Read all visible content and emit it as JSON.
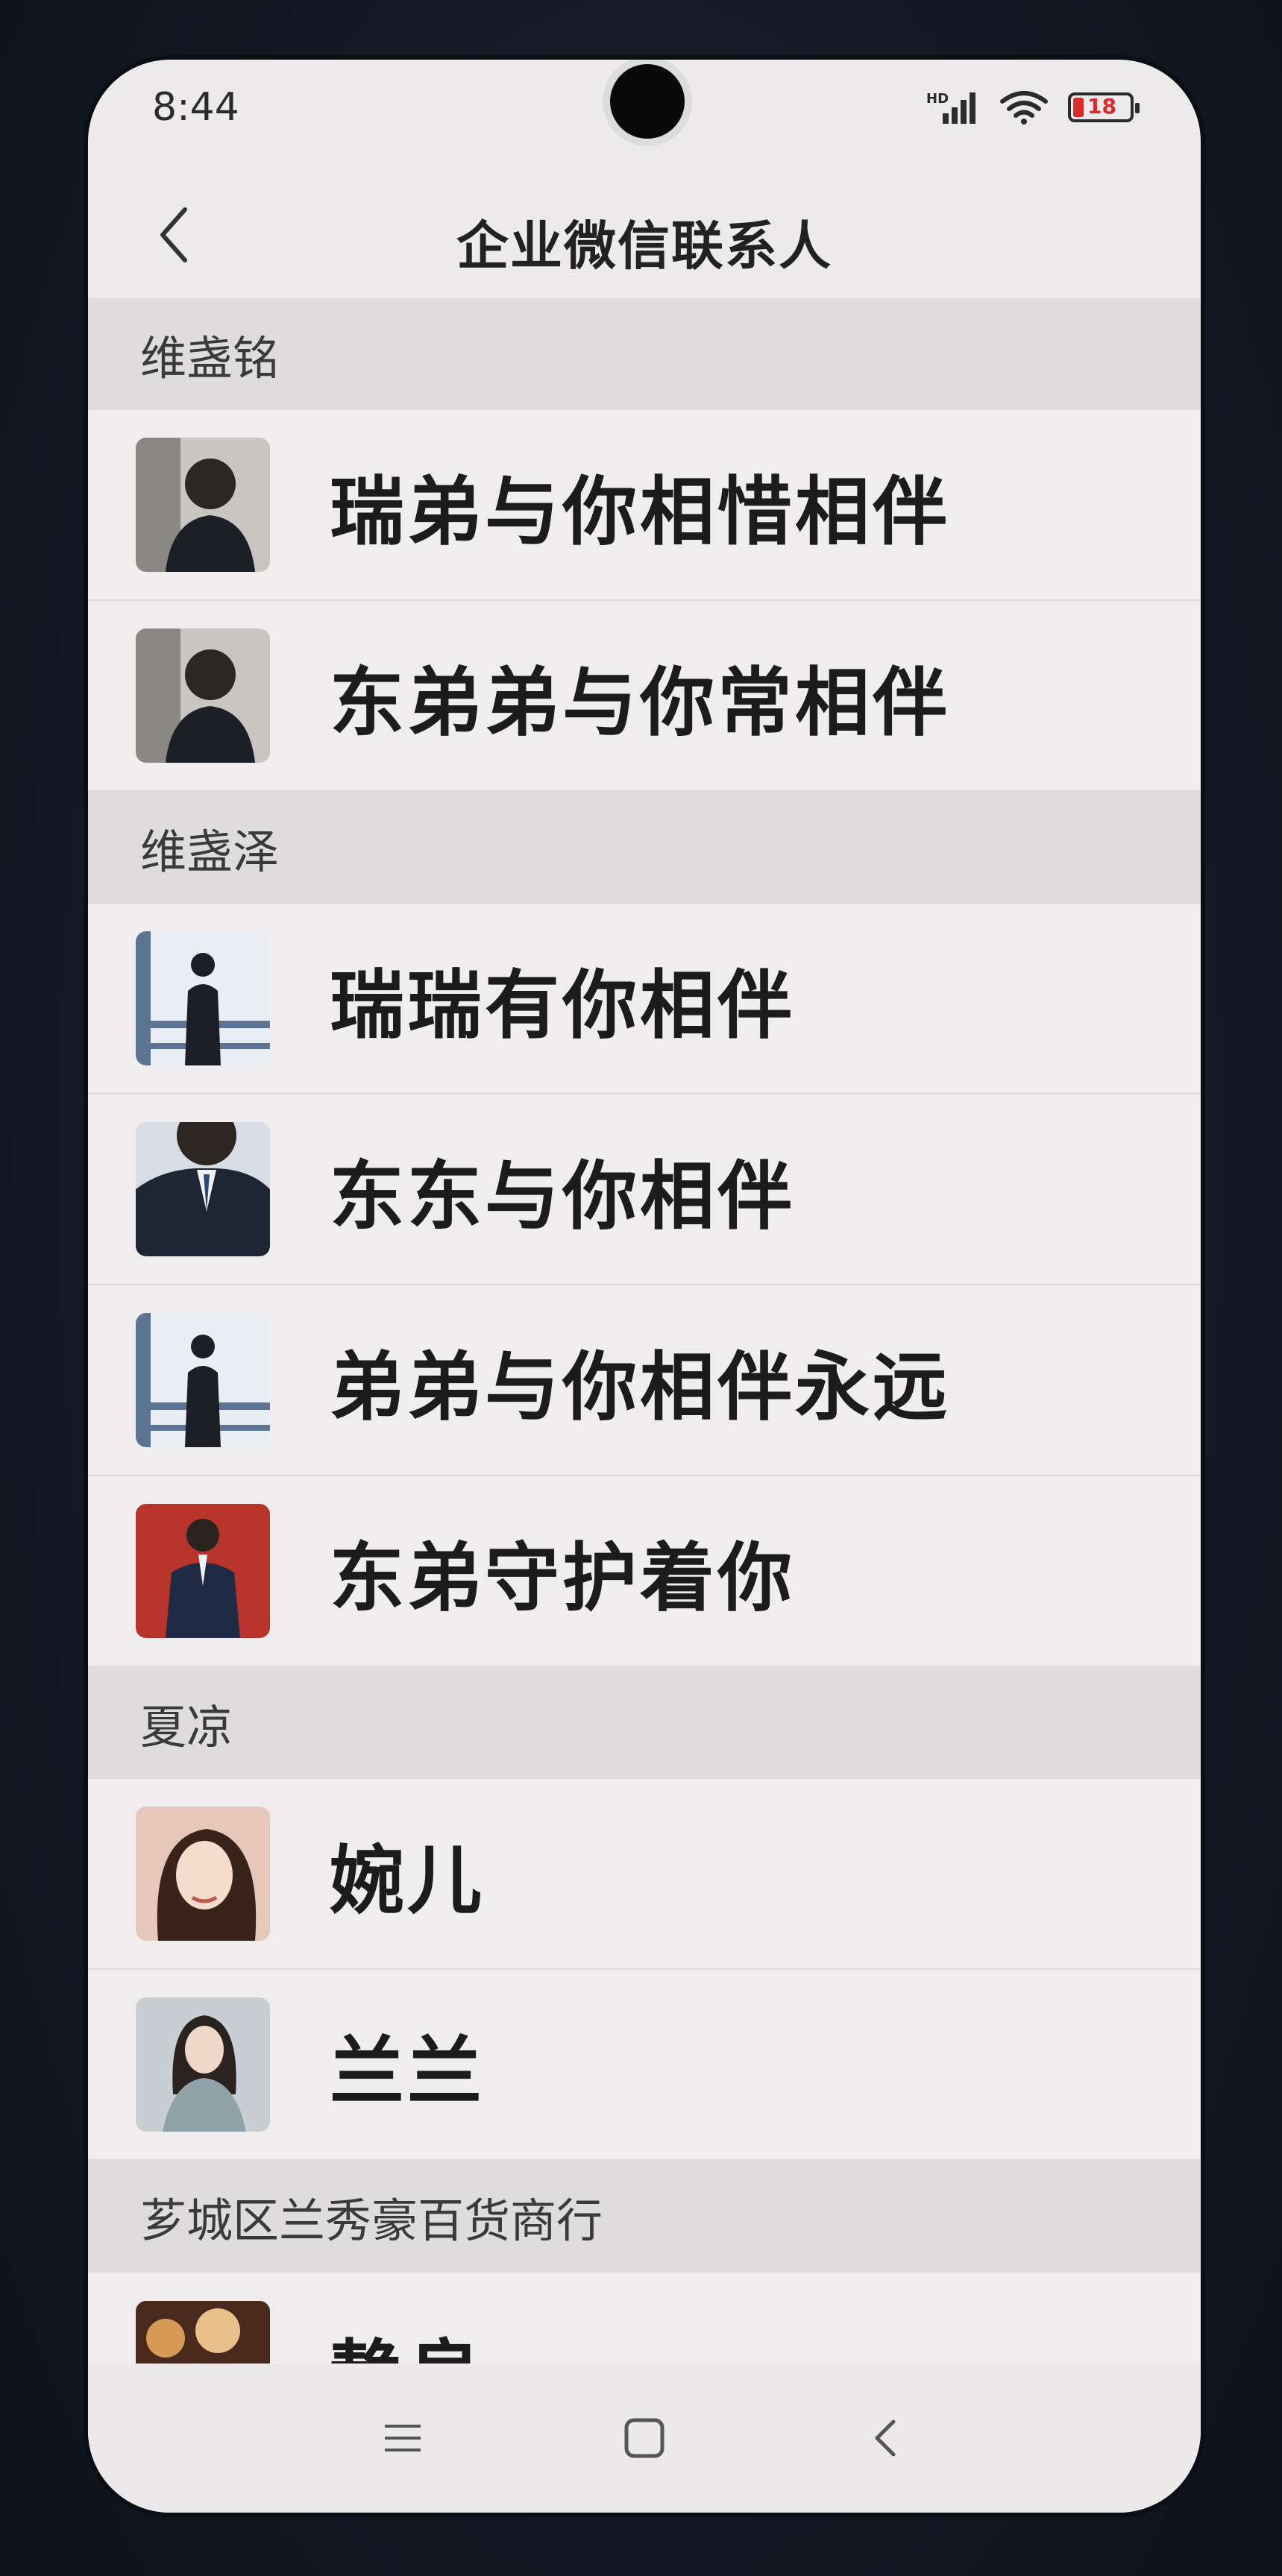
{
  "status_bar": {
    "time": "8:44",
    "signal_label": "HD",
    "battery_level": "18",
    "battery_color": "#d92b2b"
  },
  "header": {
    "title": "企业微信联系人"
  },
  "groups": [
    {
      "name": "维盏铭",
      "contacts": [
        {
          "name": "瑞弟与你相惜相伴",
          "avatar": "man-in-suit-portrait"
        },
        {
          "name": "东弟弟与你常相伴",
          "avatar": "man-in-suit-portrait"
        }
      ]
    },
    {
      "name": "维盏泽",
      "contacts": [
        {
          "name": "瑞瑞有你相伴",
          "avatar": "man-standing-at-window"
        },
        {
          "name": "东东与你相伴",
          "avatar": "man-in-suit-closeup"
        },
        {
          "name": "弟弟与你相伴永远",
          "avatar": "man-standing-at-window"
        },
        {
          "name": "东弟守护着你",
          "avatar": "man-in-suit-red-background"
        }
      ]
    },
    {
      "name": "夏凉",
      "contacts": [
        {
          "name": "婉儿",
          "avatar": "woman-portrait"
        },
        {
          "name": "兰兰",
          "avatar": "woman-sitting-portrait"
        }
      ]
    },
    {
      "name": "芗城区兰秀豪百货商行",
      "contacts": [
        {
          "name": "静良",
          "avatar": "flower-photo"
        }
      ]
    }
  ],
  "nav": {
    "menu_icon": "menu-icon",
    "home_icon": "home-square-icon",
    "back_icon": "back-chevron-icon"
  }
}
